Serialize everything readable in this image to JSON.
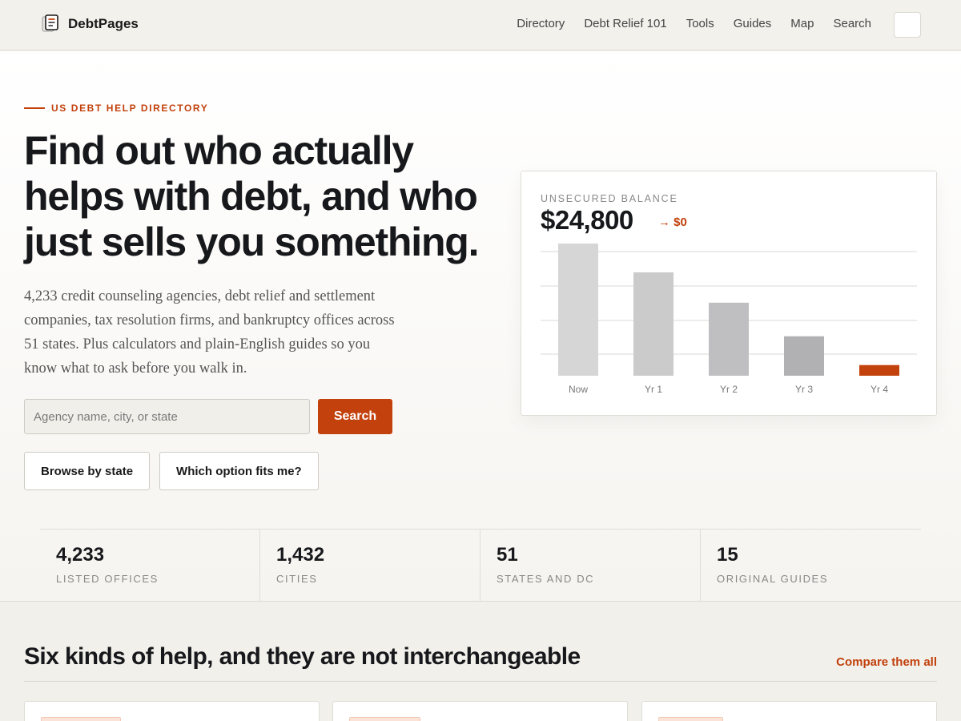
{
  "header": {
    "brand": "DebtPages",
    "nav": [
      "Directory",
      "Debt Relief 101",
      "Tools",
      "Guides",
      "Map",
      "Search"
    ]
  },
  "hero": {
    "eyebrow": "US DEBT HELP DIRECTORY",
    "title": "Find out who actually helps with debt, and who just sells you something.",
    "description": "4,233 credit counseling agencies, debt relief and settlement companies, tax resolution firms, and bankruptcy offices across 51 states. Plus calculators and plain-English guides so you know what to ask before you walk in.",
    "search_placeholder": "Agency name, city, or state",
    "search_button": "Search",
    "browse_button": "Browse by state",
    "fit_button": "Which option fits me?"
  },
  "chart_card": {
    "label": "UNSECURED BALANCE",
    "value": "$24,800",
    "target": "→ $0"
  },
  "chart_data": {
    "type": "bar",
    "categories": [
      "Now",
      "Yr 1",
      "Yr 2",
      "Yr 3",
      "Yr 4"
    ],
    "values": [
      24800,
      19400,
      13700,
      7400,
      2000
    ],
    "ylim": [
      0,
      24800
    ],
    "grid": true,
    "colors": [
      "#d6d6d6",
      "#cbcbcb",
      "#bfbfc1",
      "#b1b1b3",
      "#c2410c"
    ]
  },
  "stats": [
    {
      "number": "4,233",
      "label": "LISTED OFFICES"
    },
    {
      "number": "1,432",
      "label": "CITIES"
    },
    {
      "number": "51",
      "label": "STATES AND DC"
    },
    {
      "number": "15",
      "label": "ORIGINAL GUIDES"
    }
  ],
  "section": {
    "title": "Six kinds of help, and they are not interchangeable",
    "link": "Compare them all"
  },
  "colors": {
    "accent": "#c2410c",
    "background": "#f4f2ee"
  }
}
